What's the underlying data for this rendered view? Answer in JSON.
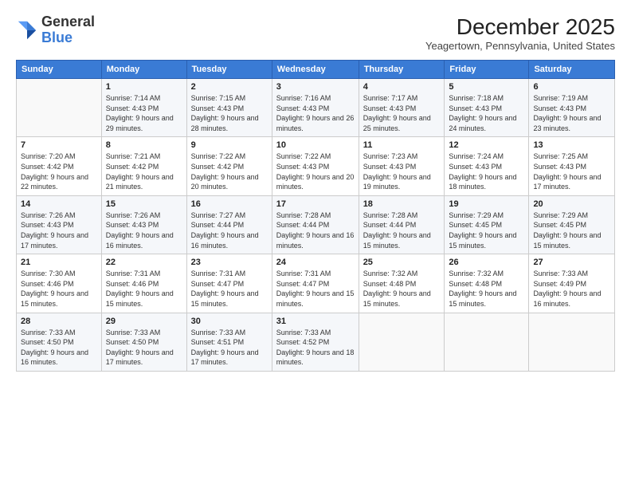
{
  "header": {
    "logo_general": "General",
    "logo_blue": "Blue",
    "month_year": "December 2025",
    "location": "Yeagertown, Pennsylvania, United States"
  },
  "weekdays": [
    "Sunday",
    "Monday",
    "Tuesday",
    "Wednesday",
    "Thursday",
    "Friday",
    "Saturday"
  ],
  "weeks": [
    [
      {
        "day": "",
        "sunrise": "",
        "sunset": "",
        "daylight": ""
      },
      {
        "day": "1",
        "sunrise": "Sunrise: 7:14 AM",
        "sunset": "Sunset: 4:43 PM",
        "daylight": "Daylight: 9 hours and 29 minutes."
      },
      {
        "day": "2",
        "sunrise": "Sunrise: 7:15 AM",
        "sunset": "Sunset: 4:43 PM",
        "daylight": "Daylight: 9 hours and 28 minutes."
      },
      {
        "day": "3",
        "sunrise": "Sunrise: 7:16 AM",
        "sunset": "Sunset: 4:43 PM",
        "daylight": "Daylight: 9 hours and 26 minutes."
      },
      {
        "day": "4",
        "sunrise": "Sunrise: 7:17 AM",
        "sunset": "Sunset: 4:43 PM",
        "daylight": "Daylight: 9 hours and 25 minutes."
      },
      {
        "day": "5",
        "sunrise": "Sunrise: 7:18 AM",
        "sunset": "Sunset: 4:43 PM",
        "daylight": "Daylight: 9 hours and 24 minutes."
      },
      {
        "day": "6",
        "sunrise": "Sunrise: 7:19 AM",
        "sunset": "Sunset: 4:43 PM",
        "daylight": "Daylight: 9 hours and 23 minutes."
      }
    ],
    [
      {
        "day": "7",
        "sunrise": "Sunrise: 7:20 AM",
        "sunset": "Sunset: 4:42 PM",
        "daylight": "Daylight: 9 hours and 22 minutes."
      },
      {
        "day": "8",
        "sunrise": "Sunrise: 7:21 AM",
        "sunset": "Sunset: 4:42 PM",
        "daylight": "Daylight: 9 hours and 21 minutes."
      },
      {
        "day": "9",
        "sunrise": "Sunrise: 7:22 AM",
        "sunset": "Sunset: 4:42 PM",
        "daylight": "Daylight: 9 hours and 20 minutes."
      },
      {
        "day": "10",
        "sunrise": "Sunrise: 7:22 AM",
        "sunset": "Sunset: 4:43 PM",
        "daylight": "Daylight: 9 hours and 20 minutes."
      },
      {
        "day": "11",
        "sunrise": "Sunrise: 7:23 AM",
        "sunset": "Sunset: 4:43 PM",
        "daylight": "Daylight: 9 hours and 19 minutes."
      },
      {
        "day": "12",
        "sunrise": "Sunrise: 7:24 AM",
        "sunset": "Sunset: 4:43 PM",
        "daylight": "Daylight: 9 hours and 18 minutes."
      },
      {
        "day": "13",
        "sunrise": "Sunrise: 7:25 AM",
        "sunset": "Sunset: 4:43 PM",
        "daylight": "Daylight: 9 hours and 17 minutes."
      }
    ],
    [
      {
        "day": "14",
        "sunrise": "Sunrise: 7:26 AM",
        "sunset": "Sunset: 4:43 PM",
        "daylight": "Daylight: 9 hours and 17 minutes."
      },
      {
        "day": "15",
        "sunrise": "Sunrise: 7:26 AM",
        "sunset": "Sunset: 4:43 PM",
        "daylight": "Daylight: 9 hours and 16 minutes."
      },
      {
        "day": "16",
        "sunrise": "Sunrise: 7:27 AM",
        "sunset": "Sunset: 4:44 PM",
        "daylight": "Daylight: 9 hours and 16 minutes."
      },
      {
        "day": "17",
        "sunrise": "Sunrise: 7:28 AM",
        "sunset": "Sunset: 4:44 PM",
        "daylight": "Daylight: 9 hours and 16 minutes."
      },
      {
        "day": "18",
        "sunrise": "Sunrise: 7:28 AM",
        "sunset": "Sunset: 4:44 PM",
        "daylight": "Daylight: 9 hours and 15 minutes."
      },
      {
        "day": "19",
        "sunrise": "Sunrise: 7:29 AM",
        "sunset": "Sunset: 4:45 PM",
        "daylight": "Daylight: 9 hours and 15 minutes."
      },
      {
        "day": "20",
        "sunrise": "Sunrise: 7:29 AM",
        "sunset": "Sunset: 4:45 PM",
        "daylight": "Daylight: 9 hours and 15 minutes."
      }
    ],
    [
      {
        "day": "21",
        "sunrise": "Sunrise: 7:30 AM",
        "sunset": "Sunset: 4:46 PM",
        "daylight": "Daylight: 9 hours and 15 minutes."
      },
      {
        "day": "22",
        "sunrise": "Sunrise: 7:31 AM",
        "sunset": "Sunset: 4:46 PM",
        "daylight": "Daylight: 9 hours and 15 minutes."
      },
      {
        "day": "23",
        "sunrise": "Sunrise: 7:31 AM",
        "sunset": "Sunset: 4:47 PM",
        "daylight": "Daylight: 9 hours and 15 minutes."
      },
      {
        "day": "24",
        "sunrise": "Sunrise: 7:31 AM",
        "sunset": "Sunset: 4:47 PM",
        "daylight": "Daylight: 9 hours and 15 minutes."
      },
      {
        "day": "25",
        "sunrise": "Sunrise: 7:32 AM",
        "sunset": "Sunset: 4:48 PM",
        "daylight": "Daylight: 9 hours and 15 minutes."
      },
      {
        "day": "26",
        "sunrise": "Sunrise: 7:32 AM",
        "sunset": "Sunset: 4:48 PM",
        "daylight": "Daylight: 9 hours and 15 minutes."
      },
      {
        "day": "27",
        "sunrise": "Sunrise: 7:33 AM",
        "sunset": "Sunset: 4:49 PM",
        "daylight": "Daylight: 9 hours and 16 minutes."
      }
    ],
    [
      {
        "day": "28",
        "sunrise": "Sunrise: 7:33 AM",
        "sunset": "Sunset: 4:50 PM",
        "daylight": "Daylight: 9 hours and 16 minutes."
      },
      {
        "day": "29",
        "sunrise": "Sunrise: 7:33 AM",
        "sunset": "Sunset: 4:50 PM",
        "daylight": "Daylight: 9 hours and 17 minutes."
      },
      {
        "day": "30",
        "sunrise": "Sunrise: 7:33 AM",
        "sunset": "Sunset: 4:51 PM",
        "daylight": "Daylight: 9 hours and 17 minutes."
      },
      {
        "day": "31",
        "sunrise": "Sunrise: 7:33 AM",
        "sunset": "Sunset: 4:52 PM",
        "daylight": "Daylight: 9 hours and 18 minutes."
      },
      {
        "day": "",
        "sunrise": "",
        "sunset": "",
        "daylight": ""
      },
      {
        "day": "",
        "sunrise": "",
        "sunset": "",
        "daylight": ""
      },
      {
        "day": "",
        "sunrise": "",
        "sunset": "",
        "daylight": ""
      }
    ]
  ]
}
